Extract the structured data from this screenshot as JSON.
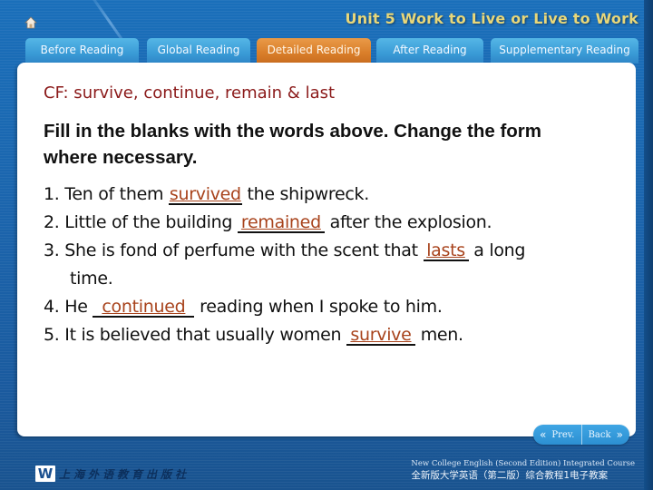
{
  "header": {
    "unit_title": "Unit 5  Work to Live or Live to Work",
    "home_icon": "home-icon"
  },
  "tabs": [
    {
      "label": "Before Reading",
      "active": false
    },
    {
      "label": "Global Reading",
      "active": false
    },
    {
      "label": "Detailed Reading",
      "active": true
    },
    {
      "label": "After Reading",
      "active": false
    },
    {
      "label": "Supplementary Reading",
      "active": false
    }
  ],
  "colors": {
    "active_tab": "#d97e2a",
    "inactive_tab": "#3a9bd6",
    "title_red": "#8b1a1a",
    "answer_color": "#a8431c",
    "unit_title_gold": "#e8d77a"
  },
  "content": {
    "cf_title": "CF: survive, continue, remain & last",
    "instruction": "Fill in the blanks with the words above. Change the form where necessary.",
    "items": [
      {
        "num": "1.",
        "before": "Ten of them ",
        "answer": "survived",
        "after": " the shipwreck."
      },
      {
        "num": "2.",
        "before": "Little of the building ",
        "answer": "remained",
        "after": " after the explosion."
      },
      {
        "num": "3.",
        "before": "She is fond of perfume with the scent that ",
        "answer": "lasts",
        "after": " a long",
        "continuation": "time."
      },
      {
        "num": "4.",
        "before": "He ",
        "answer": "continued",
        "after": " reading when I spoke to him."
      },
      {
        "num": "5.",
        "before": "It is believed that usually women ",
        "answer": "survive",
        "after": " men."
      }
    ]
  },
  "navigation": {
    "prev_label": "Prev.",
    "prev_icon": "double-chevron-left-icon",
    "back_label": "Back",
    "back_icon": "double-chevron-right-icon"
  },
  "footer": {
    "logo_letter": "W",
    "publisher": "上海外语教育出版社",
    "course_en": "New College English (Second Edition) Integrated Course",
    "course_cn": "全新版大学英语（第二版）综合教程1电子教案"
  }
}
